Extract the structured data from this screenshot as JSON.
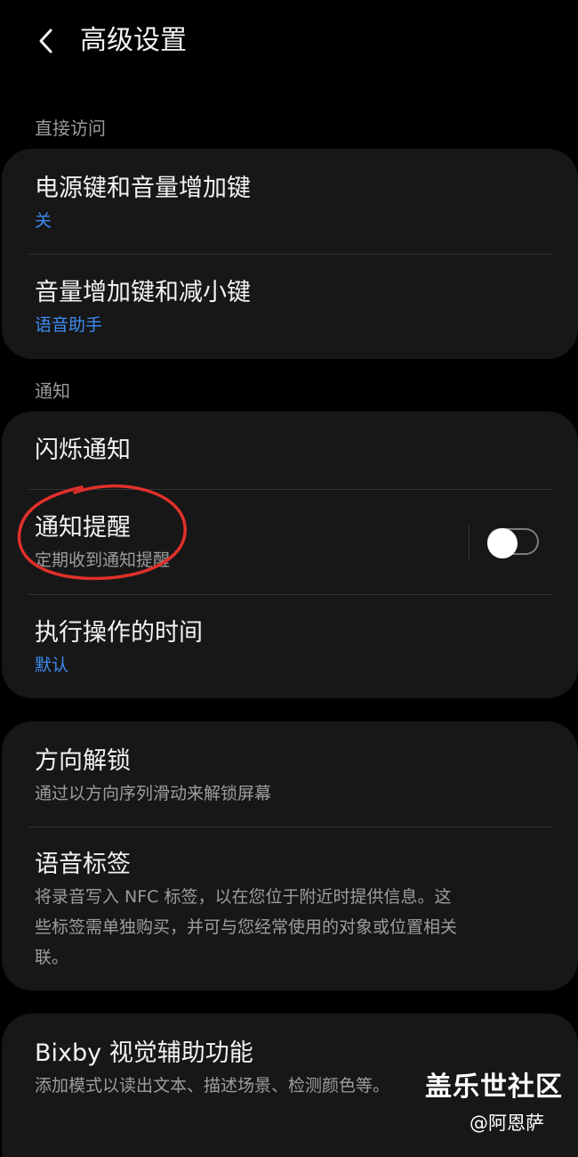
{
  "header": {
    "title": "高级设置",
    "back_icon": "chevron-left-icon"
  },
  "sections": {
    "direct_access": {
      "label": "直接访问"
    },
    "notifications": {
      "label": "通知"
    }
  },
  "direct_access": {
    "power_volume_up": {
      "title": "电源键和音量增加键",
      "value": "关"
    },
    "volume_up_down": {
      "title": "音量增加键和减小键",
      "value": "语音助手"
    }
  },
  "notify": {
    "flash": {
      "title": "闪烁通知"
    },
    "reminder": {
      "title": "通知提醒",
      "subtitle": "定期收到通知提醒",
      "toggle_on": false
    },
    "action_time": {
      "title": "执行操作的时间",
      "value": "默认"
    }
  },
  "misc": {
    "direction_lock": {
      "title": "方向解锁",
      "subtitle": "通过以方向序列滑动来解锁屏幕"
    },
    "voice_label": {
      "title": "语音标签",
      "subtitle_lines": [
        "将录音写入 NFC 标签，以在您位于附近时提供信息。这",
        "些标签需单独购买，并可与您经常使用的对象或位置相关",
        "联。"
      ]
    }
  },
  "bixby": {
    "title": "Bixby 视觉辅助功能",
    "subtitle": "添加模式以读出文本、描述场景、检测颜色等。"
  },
  "watermark": {
    "brand": "盖乐世社区",
    "user": "@阿恩萨"
  },
  "colors": {
    "background": "#000000",
    "card": "#171717",
    "accent_blue": "#3d8bf2",
    "annotation_red": "#e0302a"
  }
}
